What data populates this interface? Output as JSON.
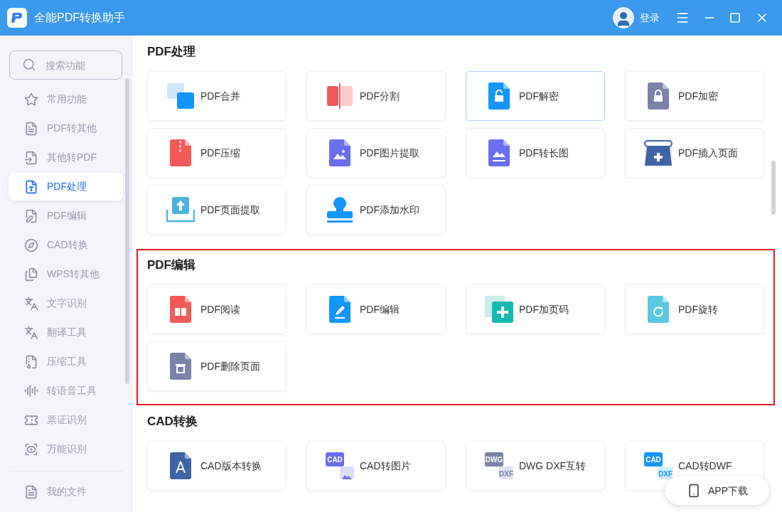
{
  "window": {
    "title": "全能PDF转换助手",
    "login": "登录"
  },
  "sidebar": {
    "search": {
      "placeholder": "搜索功能"
    },
    "items": [
      {
        "label": "常用功能",
        "selected": false
      },
      {
        "label": "PDF转其他",
        "selected": false
      },
      {
        "label": "其他转PDF",
        "selected": false
      },
      {
        "label": "PDF处理",
        "selected": true
      },
      {
        "label": "PDF编辑",
        "selected": false
      },
      {
        "label": "CAD转换",
        "selected": false
      },
      {
        "label": "WPS转其他",
        "selected": false
      },
      {
        "label": "文字识别",
        "selected": false
      },
      {
        "label": "翻译工具",
        "selected": false
      },
      {
        "label": "压缩工具",
        "selected": false
      },
      {
        "label": "转语音工具",
        "selected": false
      },
      {
        "label": "票证识别",
        "selected": false
      },
      {
        "label": "万能识别",
        "selected": false
      }
    ],
    "footer_item": {
      "label": "我的文件"
    }
  },
  "sections": [
    {
      "title": "PDF处理",
      "highlighted": false,
      "tools": [
        {
          "label": "PDF合并",
          "selected": false
        },
        {
          "label": "PDF分割",
          "selected": false
        },
        {
          "label": "PDF解密",
          "selected": true
        },
        {
          "label": "PDF加密",
          "selected": false
        },
        {
          "label": "PDF压缩",
          "selected": false
        },
        {
          "label": "PDF图片提取",
          "selected": false
        },
        {
          "label": "PDF转长图",
          "selected": false
        },
        {
          "label": "PDF插入页面",
          "selected": false
        },
        {
          "label": "PDF页面提取",
          "selected": false
        },
        {
          "label": "PDF添加水印",
          "selected": false
        }
      ]
    },
    {
      "title": "PDF编辑",
      "highlighted": true,
      "tools": [
        {
          "label": "PDF阅读",
          "selected": false
        },
        {
          "label": "PDF编辑",
          "selected": false
        },
        {
          "label": "PDF加页码",
          "selected": false
        },
        {
          "label": "PDF旋转",
          "selected": false
        },
        {
          "label": "PDF删除页面",
          "selected": false
        }
      ]
    },
    {
      "title": "CAD转换",
      "highlighted": false,
      "tools": [
        {
          "label": "CAD版本转换",
          "selected": false
        },
        {
          "label": "CAD转图片",
          "selected": false,
          "icon_text": [
            "CAD"
          ]
        },
        {
          "label": "DWG DXF互转",
          "selected": false,
          "icon_text": [
            "DWG",
            "DXF"
          ]
        },
        {
          "label": "CAD转DWF",
          "selected": false,
          "icon_text": [
            "CAD",
            "DXF"
          ]
        }
      ]
    }
  ],
  "floating_button": {
    "label": "APP下载"
  }
}
